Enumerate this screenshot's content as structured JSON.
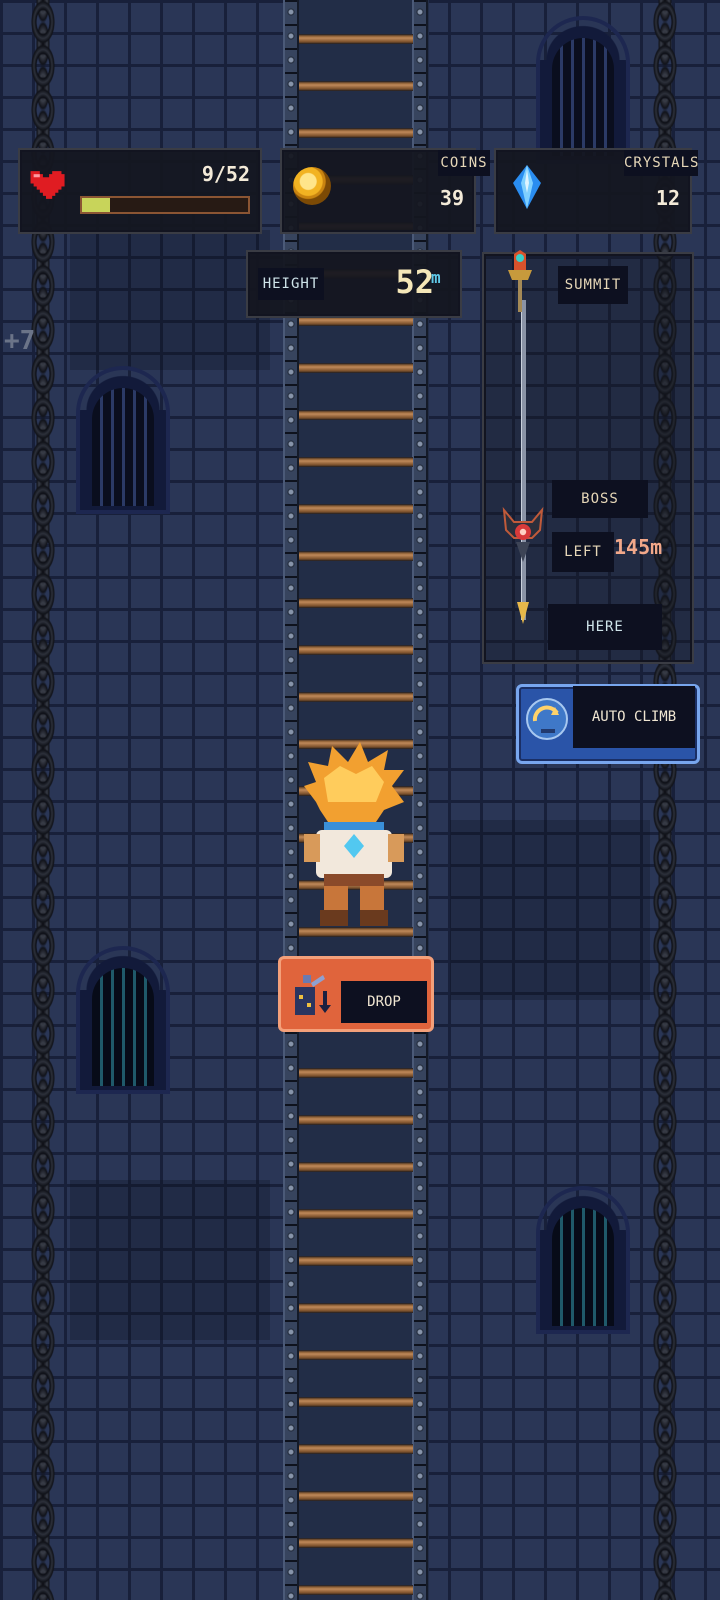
{
  "hud": {
    "health": {
      "current": "9/52",
      "fill_fraction": 0.17,
      "icon": "heart-icon"
    },
    "coins": {
      "label": "COINS",
      "value": "39",
      "icon": "coin-icon"
    },
    "crystals": {
      "label": "CRYSTALS",
      "value": "12",
      "icon": "crystal-icon"
    },
    "height": {
      "label": "HEIGHT",
      "value": "52",
      "unit": "m"
    }
  },
  "progress_map": {
    "summit_label": "SUMMIT",
    "boss_label": "BOSS",
    "left_label": "LEFT",
    "left_value": "145m",
    "here_label": "HERE"
  },
  "buttons": {
    "auto_climb": "AUTO CLIMB",
    "drop": "DROP"
  },
  "floating_text": "+7",
  "colors": {
    "drop_button": "#e0643c",
    "auto_climb_button": "#2a54a8",
    "health_fill": "#c8d45a",
    "left_value": "#f2a88a"
  }
}
